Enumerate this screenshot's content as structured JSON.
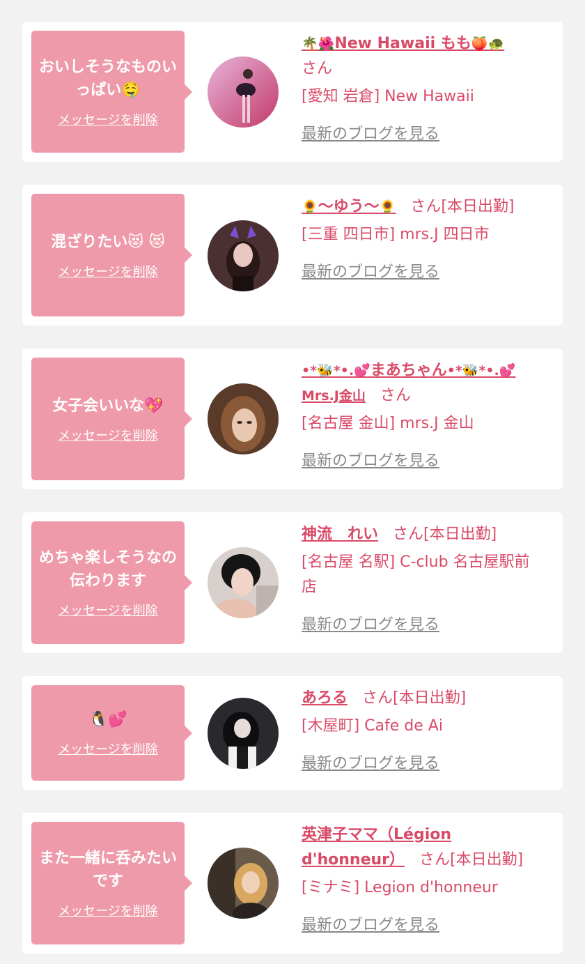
{
  "delete_label": "メッセージを削除",
  "blog_label": "最新のブログを見る",
  "san_label": "さん",
  "messages": [
    {
      "message": "おいしそうなものいっぱい🤤",
      "name_prefix": "🌴🌺",
      "name": "New Hawaii もも",
      "name_suffix": "🍑🐢",
      "status": "さん",
      "shop": "[愛知 岩倉] New Hawaii",
      "avatar": "avatar-photo-dancer"
    },
    {
      "message": "混ざりたい😻 😻",
      "name_prefix": "🌻",
      "name": "〜ゆう〜",
      "name_suffix": "🌻",
      "status": "さん[本日出勤]",
      "shop": "[三重 四日市] mrs.J 四日市",
      "avatar": "avatar-photo-cat-ears"
    },
    {
      "message": "女子会いいな💖",
      "name_prefix": "•*🐝*•.💕",
      "name": "まあちゃん",
      "name_suffix": "•*🐝*•.💕Mrs.J金山",
      "status": "さん",
      "shop": "[名古屋 金山] mrs.J 金山",
      "avatar": "avatar-photo-brown-hair"
    },
    {
      "message": "めちゃ楽しそうなの伝わります",
      "name_prefix": "",
      "name": "神流　れい",
      "name_suffix": "",
      "status": "さん[本日出勤]",
      "shop": "[名古屋 名駅] C-club 名古屋駅前店",
      "avatar": "avatar-photo-black-hair"
    },
    {
      "message": "🐧💕",
      "name_prefix": "",
      "name": "あろる",
      "name_suffix": "",
      "status": "さん[本日出勤]",
      "shop": "[木屋町] Cafe de Ai",
      "avatar": "avatar-photo-maid"
    },
    {
      "message": "また一緒に呑みたいです",
      "name_prefix": "",
      "name": "英津子ママ（Légion d'honneur）",
      "name_suffix": "",
      "status": "さん[本日出勤]",
      "shop": "[ミナミ] Legion d'honneur",
      "avatar": "avatar-photo-blonde"
    }
  ],
  "colors": {
    "accent": "#d94a68",
    "bubble": "#ee9aaa",
    "background": "#f2f2f2",
    "link_gray": "#888888"
  }
}
